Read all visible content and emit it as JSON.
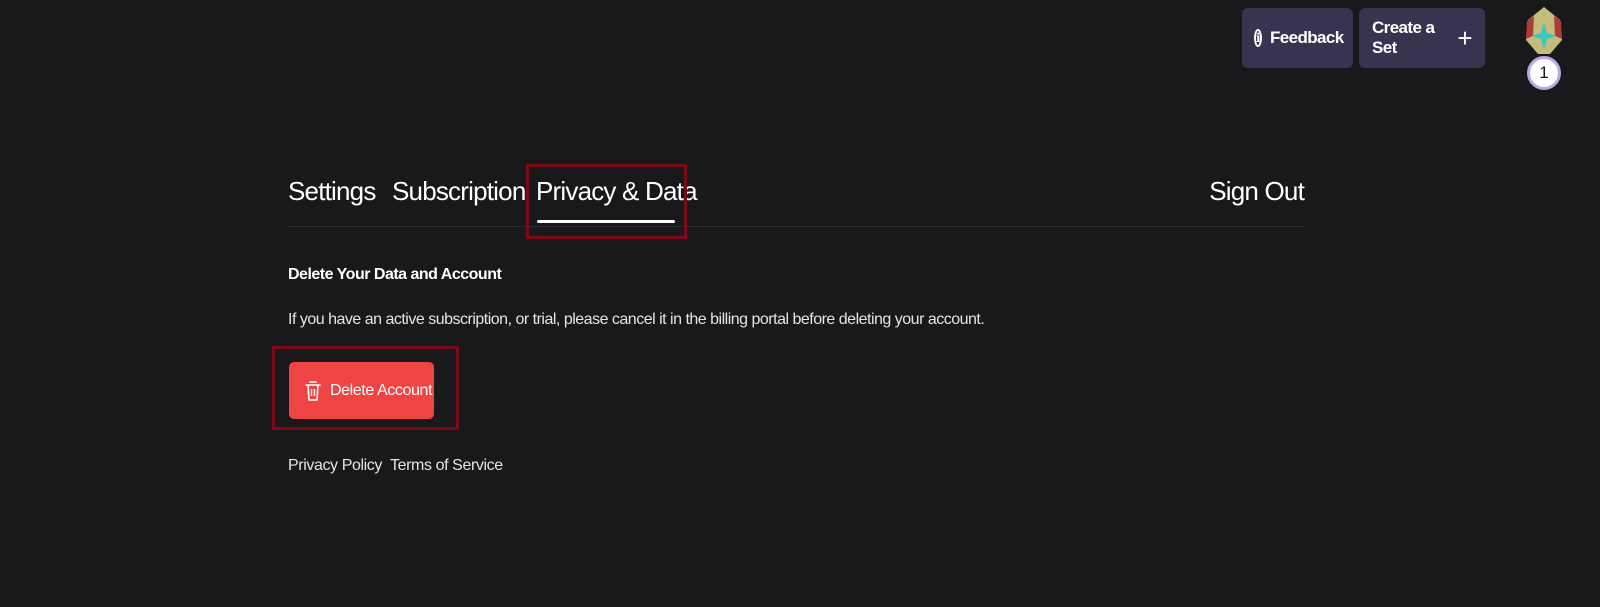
{
  "header": {
    "feedback_label": "Feedback",
    "feedback_icon": "info-icon",
    "create_set_label": "Create a Set",
    "create_set_icon": "plus-icon",
    "level_badge": "1"
  },
  "tabs": [
    {
      "label": "Settings"
    },
    {
      "label": "Subscription"
    },
    {
      "label": "Privacy & Data",
      "active": true
    }
  ],
  "sign_out_label": "Sign Out",
  "privacy": {
    "title": "Delete Your Data and Account",
    "description": "If you have an active subscription, or trial, please cancel it in the billing portal before deleting your account.",
    "delete_button_label": "Delete Account",
    "delete_button_icon": "trash-icon"
  },
  "footer": {
    "privacy_policy": "Privacy Policy",
    "terms": "Terms of Service"
  },
  "colors": {
    "background": "#19191b",
    "header_button": "#3a3350",
    "danger": "#ef4444",
    "highlight": "#7b0c17"
  }
}
